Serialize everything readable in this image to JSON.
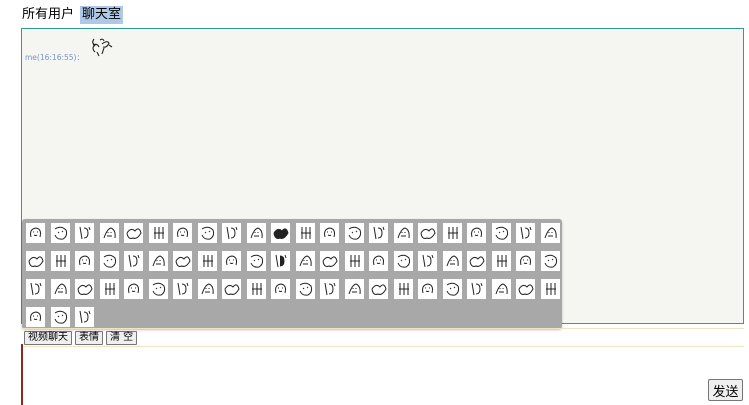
{
  "tabs": [
    {
      "label": "所有用户",
      "active": false
    },
    {
      "label": "聊天室",
      "active": true
    }
  ],
  "chat": {
    "messages": [
      {
        "meta": "me(16:16:55)：",
        "emoji": "doodle-emoji"
      }
    ]
  },
  "emoji_panel": {
    "icon": "doodle-emoji",
    "rows": [
      22,
      22,
      22,
      3
    ],
    "count": 69
  },
  "toolbar": {
    "video_chat_label": "视频聊天",
    "emoji_label": "表情",
    "clear_label": "清 空"
  },
  "input": {
    "value": "",
    "placeholder": ""
  },
  "send_label": "发送",
  "colors": {
    "chat_border": "#2f9c90",
    "chat_bg": "#f5f6f2",
    "active_tab_bg": "#aec9e8",
    "panel_bg": "#a8a8a8",
    "meta_text": "#7a94c4"
  }
}
